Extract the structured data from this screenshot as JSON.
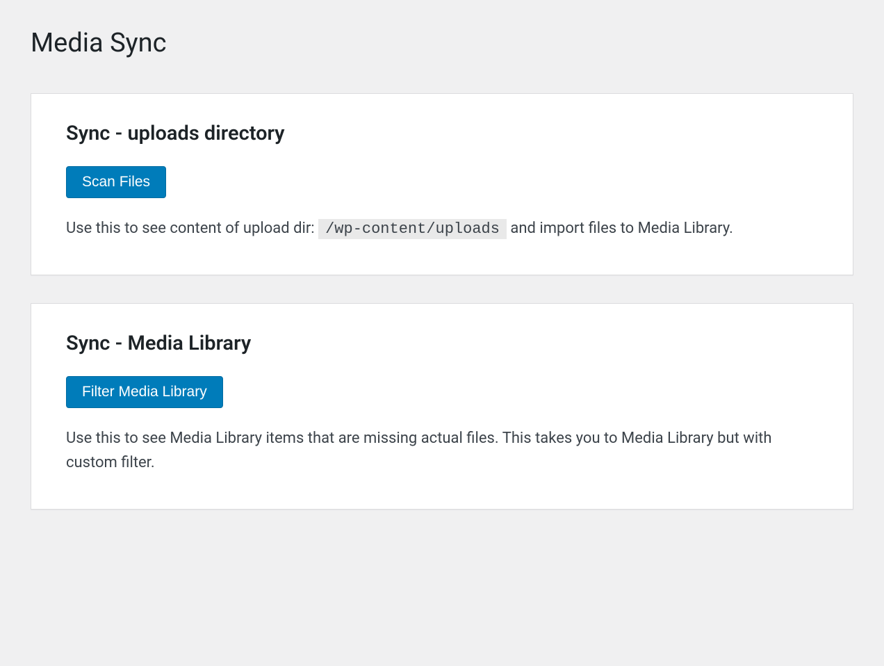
{
  "page": {
    "title": "Media Sync"
  },
  "cards": {
    "uploads": {
      "title": "Sync - uploads directory",
      "button": "Scan Files",
      "desc_before": "Use this to see content of upload dir: ",
      "path": "/wp-content/uploads",
      "desc_after": " and import files to Media Library."
    },
    "library": {
      "title": "Sync - Media Library",
      "button": "Filter Media Library",
      "desc": "Use this to see Media Library items that are missing actual files. This takes you to Media Library but with custom filter."
    }
  }
}
